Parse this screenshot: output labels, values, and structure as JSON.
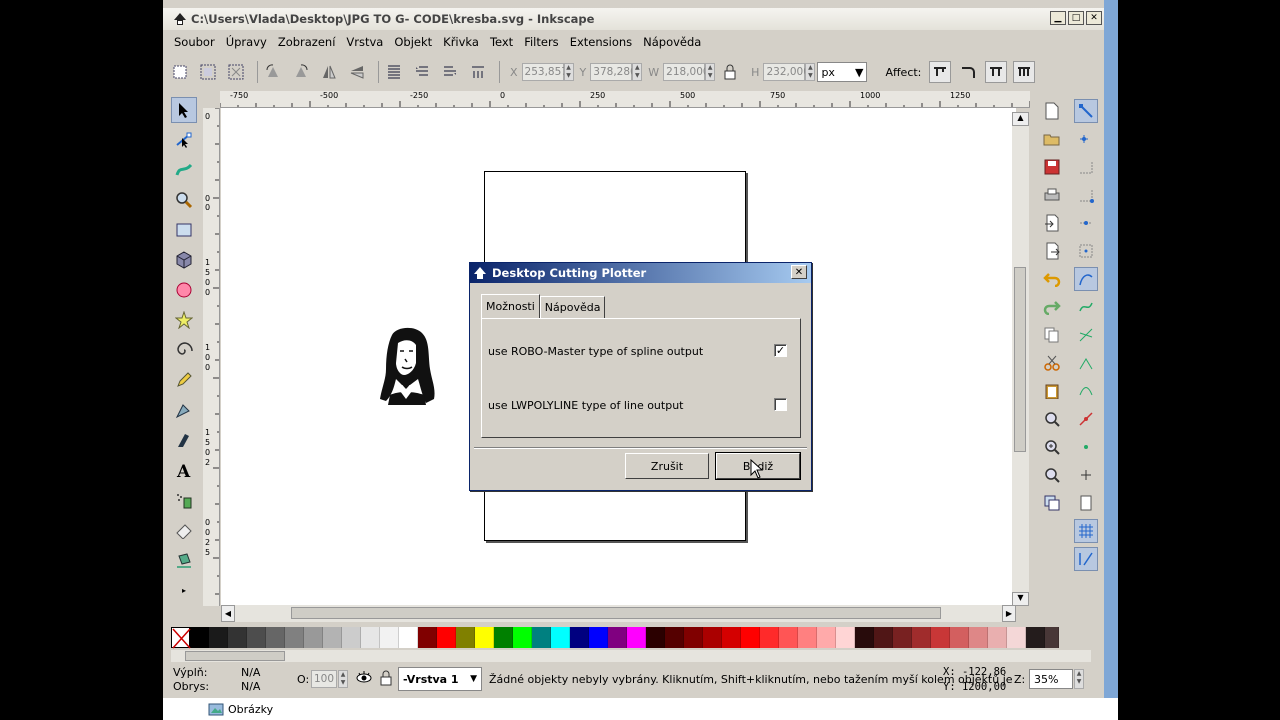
{
  "window": {
    "title": "C:\\Users\\Vlada\\Desktop\\JPG TO G- CODE\\kresba.svg - Inkscape",
    "min_glyph": "▁",
    "max_glyph": "□",
    "close_glyph": "✕"
  },
  "menu": [
    "Soubor",
    "Úpravy",
    "Zobrazení",
    "Vrstva",
    "Objekt",
    "Křivka",
    "Text",
    "Filters",
    "Extensions",
    "Nápověda"
  ],
  "toolbar": {
    "x_label": "X",
    "x_value": "253,857",
    "y_label": "Y",
    "y_value": "378,286",
    "w_label": "W",
    "w_value": "218,000",
    "h_label": "H",
    "h_value": "232,000",
    "unit": "px",
    "affect_label": "Affect:"
  },
  "ruler_h_labels": [
    "-750",
    "-500",
    "-250",
    "0",
    "250",
    "500",
    "750",
    "1000",
    "1250"
  ],
  "ruler_v_labels": [
    "0",
    "0",
    "0",
    "1",
    "5",
    "0",
    "0",
    "1",
    "0",
    "0",
    "1",
    "5",
    "0",
    "2",
    "0",
    "0",
    "2",
    "5"
  ],
  "palette": [
    "#000000",
    "#1a1a1a",
    "#333333",
    "#4d4d4d",
    "#666666",
    "#808080",
    "#999999",
    "#b3b3b3",
    "#cccccc",
    "#e6e6e6",
    "#f2f2f2",
    "#ffffff",
    "#800000",
    "#ff0000",
    "#808000",
    "#ffff00",
    "#008000",
    "#00ff00",
    "#008080",
    "#00ffff",
    "#000080",
    "#0000ff",
    "#800080",
    "#ff00ff",
    "#2b0000",
    "#550000",
    "#800000",
    "#aa0000",
    "#d40000",
    "#ff0000",
    "#ff2a2a",
    "#ff5555",
    "#ff8080",
    "#ffaaaa",
    "#ffd5d5",
    "#280b0b",
    "#501616",
    "#782121",
    "#a02c2c",
    "#c83737",
    "#d35f5f",
    "#de8787",
    "#e9afaf",
    "#f4d7d7",
    "#241c1c",
    "#483737"
  ],
  "status": {
    "fill_label": "Výplň:",
    "fill_value": "N/A",
    "stroke_label": "Obrys:",
    "stroke_value": "N/A",
    "opacity_label": "O:",
    "opacity_value": "100",
    "layer": "-Vrstva 1",
    "message": "Žádné objekty nebyly vybrány. Kliknutím, Shift+kliknutím, nebo tažením myší kolem objektů je",
    "x_coord": "X: -122,86",
    "y_coord": "Y: 1200,00",
    "zoom_label": "Z:",
    "zoom_value": "35%"
  },
  "dialog": {
    "title": "Desktop Cutting Plotter",
    "close_glyph": "✕",
    "tabs": [
      "Možnosti",
      "Nápověda"
    ],
    "options": [
      {
        "label": "use ROBO-Master type of spline output",
        "checked": true,
        "mark": "✓"
      },
      {
        "label": "use LWPOLYLINE type of line output",
        "checked": false,
        "mark": ""
      }
    ],
    "cancel": "Zrušit",
    "ok": "Budiž"
  },
  "taskbar": {
    "item": "Obrázky"
  }
}
